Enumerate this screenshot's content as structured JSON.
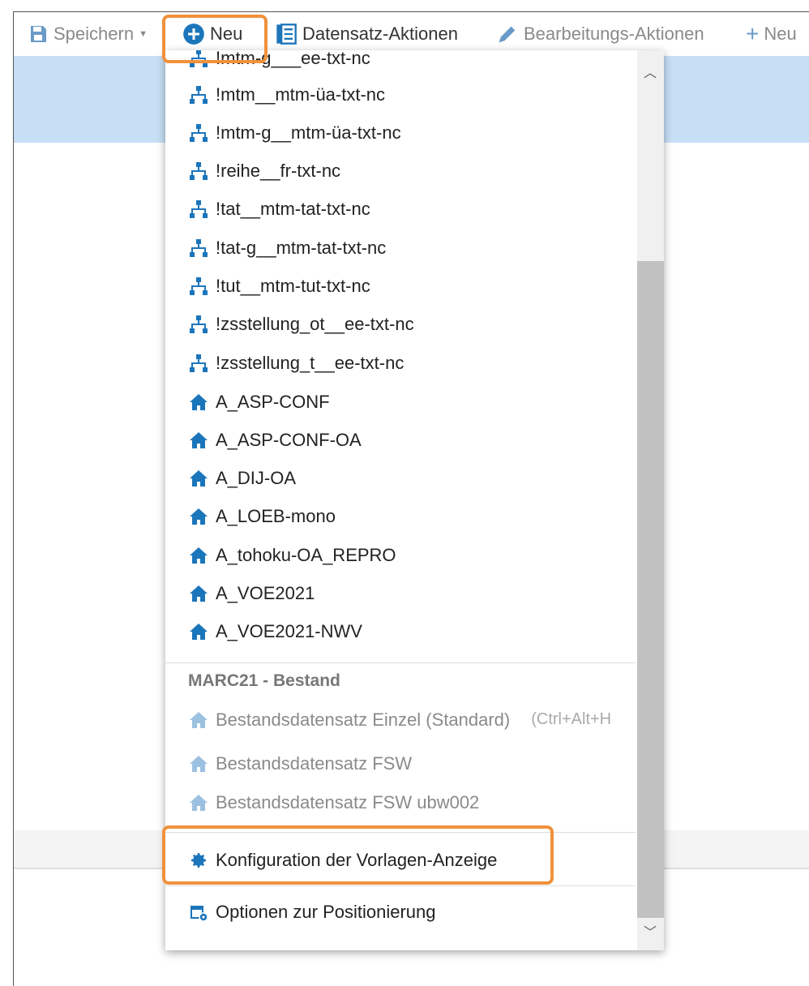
{
  "toolbar": {
    "save_label": "Speichern",
    "new_label": "Neu",
    "record_actions_label": "Datensatz-Aktionen",
    "edit_actions_label": "Bearbeitungs-Aktionen",
    "new2_label": "Neu"
  },
  "menu": {
    "partial_item": "!mtm-g___ee-txt-nc",
    "structure_items": [
      "!mtm__mtm-üa-txt-nc",
      "!mtm-g__mtm-üa-txt-nc",
      "!reihe__fr-txt-nc",
      "!tat__mtm-tat-txt-nc",
      "!tat-g__mtm-tat-txt-nc",
      "!tut__mtm-tut-txt-nc",
      "!zsstellung_ot__ee-txt-nc",
      "!zsstellung_t__ee-txt-nc"
    ],
    "home_items": [
      "A_ASP-CONF",
      "A_ASP-CONF-OA",
      "A_DIJ-OA",
      "A_LOEB-mono",
      "A_tohoku-OA_REPRO",
      "A_VOE2021",
      "A_VOE2021-NWV"
    ],
    "section_title": "MARC21 - Bestand",
    "holding_items": [
      {
        "label": "Bestandsdatensatz Einzel (Standard)",
        "shortcut": "(Ctrl+Alt+H"
      },
      {
        "label": "Bestandsdatensatz FSW",
        "shortcut": ""
      },
      {
        "label": "Bestandsdatensatz FSW ubw002",
        "shortcut": ""
      }
    ],
    "config_label": "Konfiguration der Vorlagen-Anzeige",
    "positioning_label": "Optionen zur Positionierung"
  },
  "colors": {
    "accent": "#1b75bb",
    "highlight": "#f0913c",
    "selected_band": "#c7dff5"
  },
  "icons": {
    "structure": "sitemap-icon",
    "home": "home-icon",
    "config": "gear-icon",
    "positioning": "calendar-gear-icon"
  }
}
